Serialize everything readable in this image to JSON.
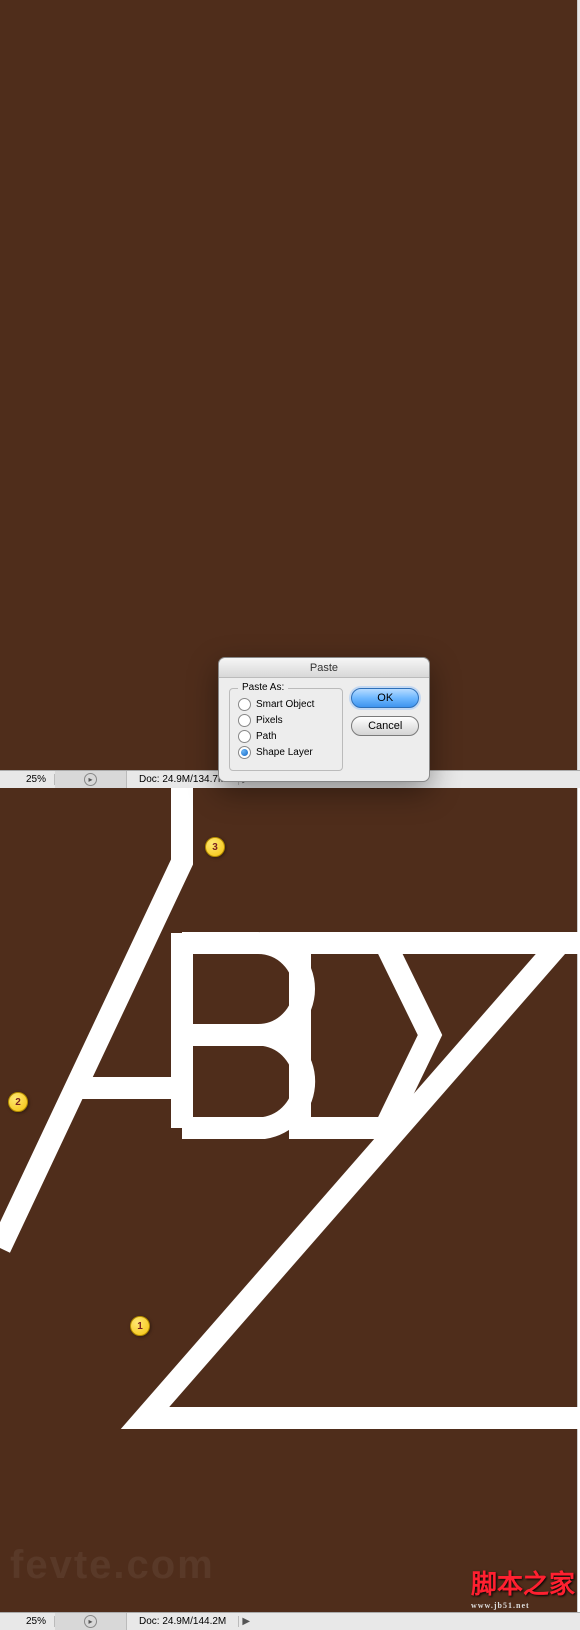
{
  "dialog": {
    "title": "Paste",
    "fieldset_label": "Paste As:",
    "options": {
      "smart_object": "Smart Object",
      "pixels": "Pixels",
      "path": "Path",
      "shape_layer": "Shape Layer"
    },
    "selected": "shape_layer",
    "ok_label": "OK",
    "cancel_label": "Cancel"
  },
  "status_top": {
    "zoom": "25%",
    "doc": "Doc: 24.9M/134.7M"
  },
  "status_bottom": {
    "zoom": "25%",
    "doc": "Doc: 24.9M/144.2M"
  },
  "markers": {
    "m1": "1",
    "m2": "2",
    "m3": "3"
  },
  "watermark": {
    "main": "脚本之家",
    "sub": "www.jb51.net"
  },
  "faint": "fevte.com"
}
